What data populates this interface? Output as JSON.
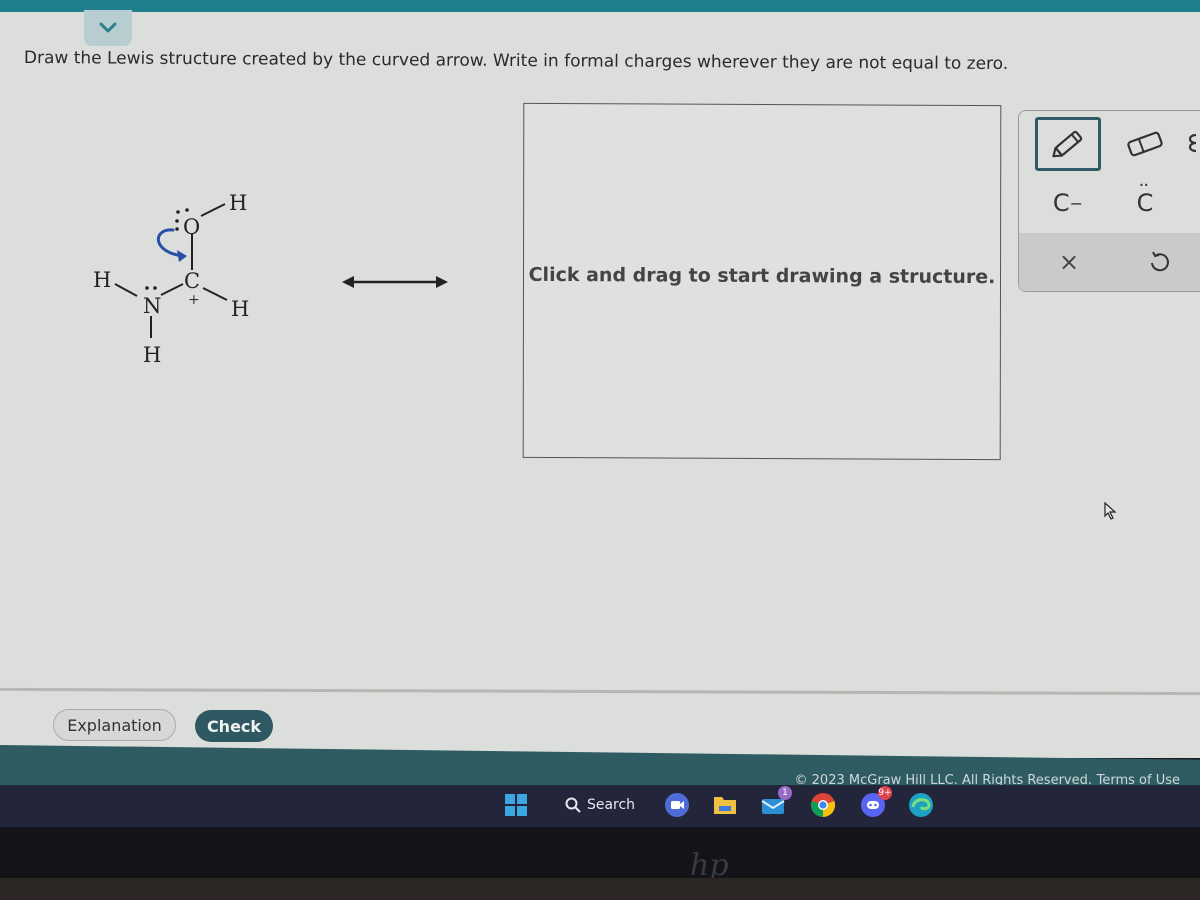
{
  "header": {
    "collapse_icon": "chevron-down-icon",
    "accent_color": "#1f7f8e"
  },
  "question": {
    "prompt": "Draw the Lewis structure created by the curved arrow. Write in formal charges wherever they are not equal to zero."
  },
  "reactant": {
    "atoms": {
      "O": "O",
      "C": "C",
      "N": "N",
      "H_O": "H",
      "H_C": "H",
      "H_N_left": "H",
      "H_N_bottom": "H"
    },
    "formal_charge_C": "+",
    "curved_arrow_color": "#2a4fa8",
    "description": "Curved arrow from a lone pair on O to the O–C bond"
  },
  "resonance_arrow": "double-headed-arrow",
  "drawing_canvas": {
    "hint": "Click and drag to start drawing a structure."
  },
  "toolbar": {
    "tools": [
      {
        "name": "pencil",
        "icon": "pencil-icon",
        "active": true
      },
      {
        "name": "eraser",
        "icon": "eraser-icon",
        "active": false
      },
      {
        "name": "more",
        "icon": "more-icon",
        "active": false
      }
    ],
    "charge_tool_label": "C",
    "charge_tool_sup": "−",
    "lone_pair_tool_label": "C",
    "lone_pair_tool_dots": "··",
    "clear_label": "×",
    "undo_icon": "undo-icon"
  },
  "actions": {
    "explanation_label": "Explanation",
    "check_label": "Check",
    "check_color": "#2e5962"
  },
  "footer": {
    "copyright": "© 2023 McGraw Hill LLC. All Rights Reserved.",
    "terms_label": "Terms of Use"
  },
  "taskbar": {
    "search_label": "Search",
    "apps": [
      {
        "name": "teams-meet",
        "badge": ""
      },
      {
        "name": "file-explorer",
        "badge": ""
      },
      {
        "name": "mail",
        "badge": "1"
      },
      {
        "name": "chrome",
        "badge": ""
      },
      {
        "name": "discord",
        "badge": "9+"
      },
      {
        "name": "edge",
        "badge": ""
      }
    ]
  },
  "device_logo": "hp"
}
